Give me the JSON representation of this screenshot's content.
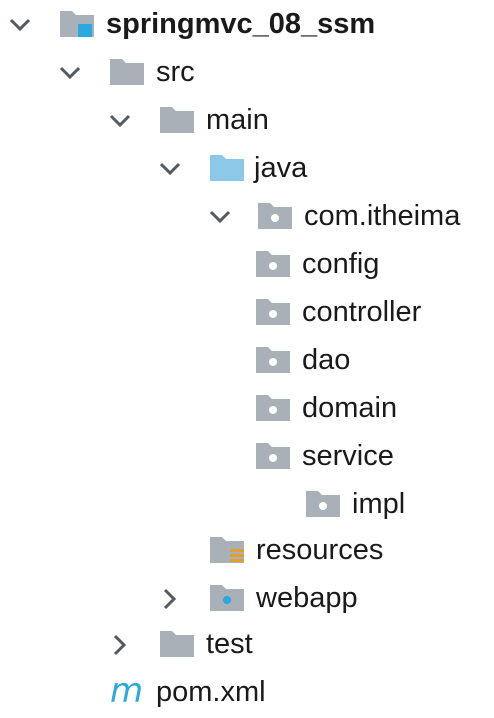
{
  "project_tree": {
    "root": {
      "label": "springmvc_08_ssm",
      "icon": "project-module-icon",
      "expanded": true
    },
    "src": {
      "label": "src",
      "icon": "folder-icon",
      "expanded": true
    },
    "main": {
      "label": "main",
      "icon": "folder-icon",
      "expanded": true
    },
    "java": {
      "label": "java",
      "icon": "source-root-folder-icon",
      "expanded": true
    },
    "package": {
      "label": "com.itheima",
      "icon": "package-icon",
      "expanded": true
    },
    "config": {
      "label": "config",
      "icon": "package-icon"
    },
    "controller": {
      "label": "controller",
      "icon": "package-icon"
    },
    "dao": {
      "label": "dao",
      "icon": "package-icon"
    },
    "domain": {
      "label": "domain",
      "icon": "package-icon"
    },
    "service": {
      "label": "service",
      "icon": "package-icon"
    },
    "impl": {
      "label": "impl",
      "icon": "package-icon"
    },
    "resources": {
      "label": "resources",
      "icon": "resources-root-folder-icon"
    },
    "webapp": {
      "label": "webapp",
      "icon": "web-folder-icon",
      "expanded": false
    },
    "test": {
      "label": "test",
      "icon": "folder-icon",
      "expanded": false
    },
    "pom": {
      "label": "pom.xml",
      "icon": "maven-m-icon",
      "glyph": "m"
    }
  },
  "colors": {
    "folder_grey": "#aab0b8",
    "source_blue": "#8cc8e8",
    "accent_blue": "#2aa8e0",
    "resource_stripes": "#e0a030",
    "chevron": "#555a60"
  }
}
